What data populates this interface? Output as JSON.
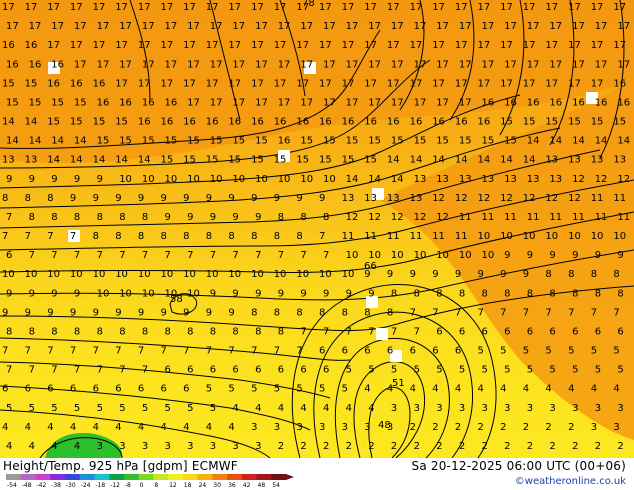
{
  "header_title": "Height/Temp. 925 hPa [gdpm] ECMWF",
  "valid_time": "Sa 20-12-2025 06:00 UTC (00+06)",
  "credit": "©weatheronline.co.uk",
  "colorbar": {
    "tick_labels": [
      "-54",
      "-48",
      "-42",
      "-38",
      "-30",
      "-24",
      "-18",
      "-12",
      "-8",
      "0",
      "8",
      "12",
      "18",
      "24",
      "30",
      "36",
      "42",
      "48",
      "54"
    ],
    "colors": [
      "#9a9a9a",
      "#b06bc0",
      "#d040d0",
      "#8a2be2",
      "#3a46d8",
      "#1e8fe0",
      "#18c0d0",
      "#10a048",
      "#30c030",
      "#7cd820",
      "#c8e820",
      "#f0f020",
      "#f8d818",
      "#f8b010",
      "#f08010",
      "#e85010",
      "#d02020",
      "#a01818",
      "#701010"
    ]
  },
  "map_labels": {
    "contour_values": [
      "78",
      "60",
      "58",
      "51",
      "48",
      "66"
    ],
    "temp_min_label": "0",
    "temp_max_label": "17"
  }
}
